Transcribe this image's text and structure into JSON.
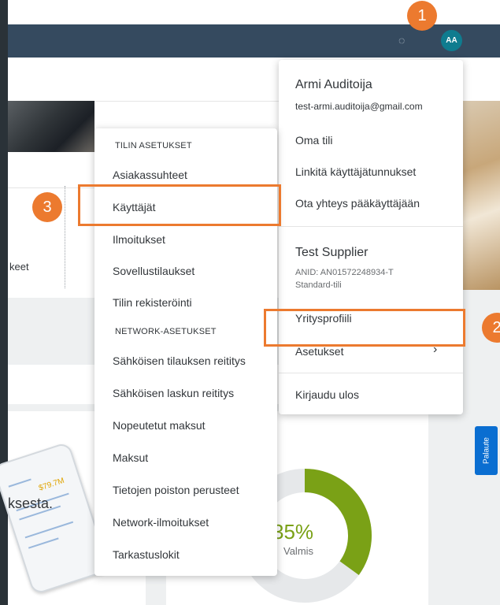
{
  "shell": {
    "avatar_initials": "AA",
    "bg_color": "#354a5f",
    "help_icon": "help-icon"
  },
  "background": {
    "partial_text_1": "keet",
    "partial_text_2": "ksesta.",
    "phone_amount": "$79.7M",
    "progress": {
      "percent_label": "35%",
      "value": 35,
      "status": "Valmis",
      "color": "#7aa116"
    },
    "feedback_label": "Palaute"
  },
  "user_menu": {
    "name": "Armi Auditoija",
    "email": "test-armi.auditoija@gmail.com",
    "items": [
      "Oma tili",
      "Linkitä käyttäjätunnukset",
      "Ota yhteys pääkäyttäjään"
    ],
    "company": "Test Supplier",
    "anid": "ANID: AN01572248934-T",
    "account_type": "Standard-tili",
    "company_profile": "Yritysprofiili",
    "settings": "Asetukset",
    "logout": "Kirjaudu ulos"
  },
  "settings_menu": {
    "account_header": "TILIN ASETUKSET",
    "account_items": [
      "Asiakassuhteet",
      "Käyttäjät",
      "Ilmoitukset",
      "Sovellustilaukset",
      "Tilin rekisteröinti"
    ],
    "network_header": "NETWORK-ASETUKSET",
    "network_items": [
      "Sähköisen tilauksen reititys",
      "Sähköisen laskun reititys",
      "Nopeutetut maksut",
      "Maksut",
      "Tietojen poiston perusteet",
      "Network-ilmoitukset",
      "Tarkastuslokit"
    ]
  },
  "callouts": {
    "one": "1",
    "two": "2",
    "three": "3",
    "color": "#ec7a2f"
  }
}
